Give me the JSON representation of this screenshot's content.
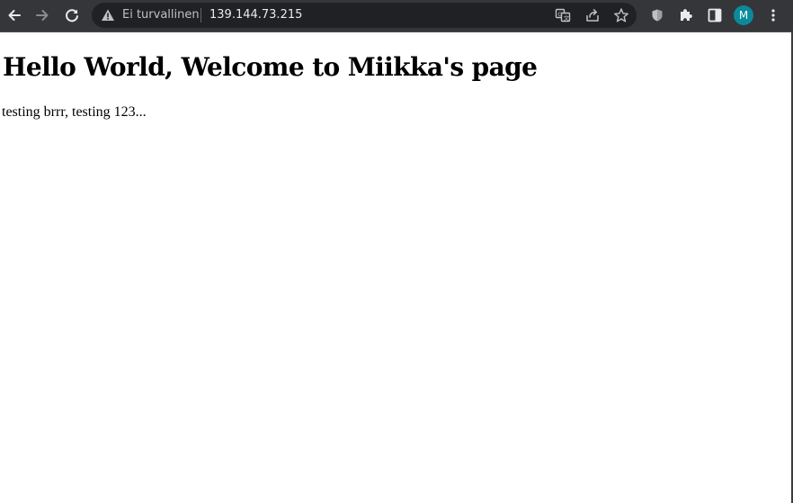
{
  "browser": {
    "security_label": "Ei turvallinen",
    "url": "139.144.73.215",
    "profile_initial": "M",
    "colors": {
      "toolbar": "#35363a",
      "omnibox": "#202124",
      "avatar": "#0a8a9c"
    },
    "icons": {
      "back": "arrow-left",
      "forward": "arrow-right",
      "reload": "reload",
      "security": "warning-triangle",
      "translate": "translate",
      "share": "share",
      "bookmark": "star",
      "extension_shield": "shield",
      "extensions": "puzzle",
      "side_panel": "side-panel",
      "menu": "three-dots-vertical"
    }
  },
  "page": {
    "heading": "Hello World, Welcome to Miikka's page",
    "paragraph": "testing brrr, testing 123..."
  }
}
